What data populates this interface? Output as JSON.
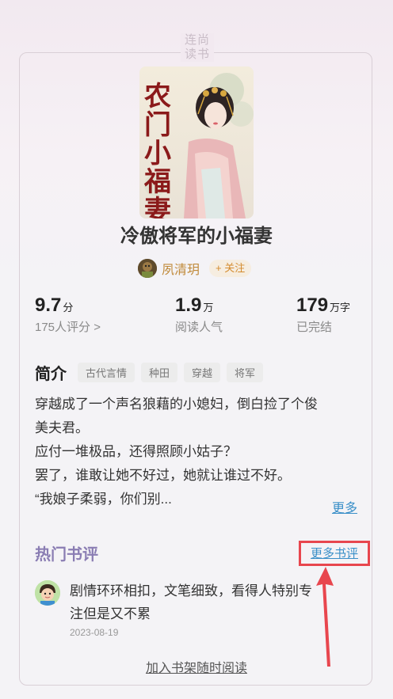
{
  "brand": {
    "line1": "连尚",
    "line2": "读书"
  },
  "book": {
    "cover_title_text": "农门小福妻",
    "title": "冷傲将军的小福妻",
    "author": "夙清玥",
    "follow_label": "+ 关注"
  },
  "stats": {
    "rating": {
      "value": "9.7",
      "unit": "分",
      "label": "175人评分 >"
    },
    "popularity": {
      "value": "1.9",
      "unit": "万",
      "label": "阅读人气"
    },
    "words": {
      "value": "179",
      "unit": "万字",
      "label": "已完结"
    }
  },
  "intro": {
    "heading": "简介",
    "tags": [
      "古代言情",
      "种田",
      "穿越",
      "将军"
    ],
    "lines": [
      "穿越成了一个声名狼藉的小媳妇，倒白捡了个俊",
      "美夫君。",
      "应付一堆极品，还得照顾小姑子？",
      "罢了，谁敢让她不好过，她就让谁过不好。",
      "“我娘子柔弱，你们别..."
    ],
    "more_label": "更多"
  },
  "reviews": {
    "heading": "热门书评",
    "more_label": "更多书评",
    "items": [
      {
        "line1": "剧情环环相扣，文笔细致，看得人特别专",
        "line2": "注但是又不累",
        "date": "2023-08-19"
      }
    ]
  },
  "footer": {
    "add_shelf_label": "加入书架随时阅读"
  },
  "colors": {
    "accent_link": "#3a8fc8",
    "highlight_box": "#e8464e",
    "author": "#c08a3a",
    "reviews_heading": "#8a7db3"
  }
}
